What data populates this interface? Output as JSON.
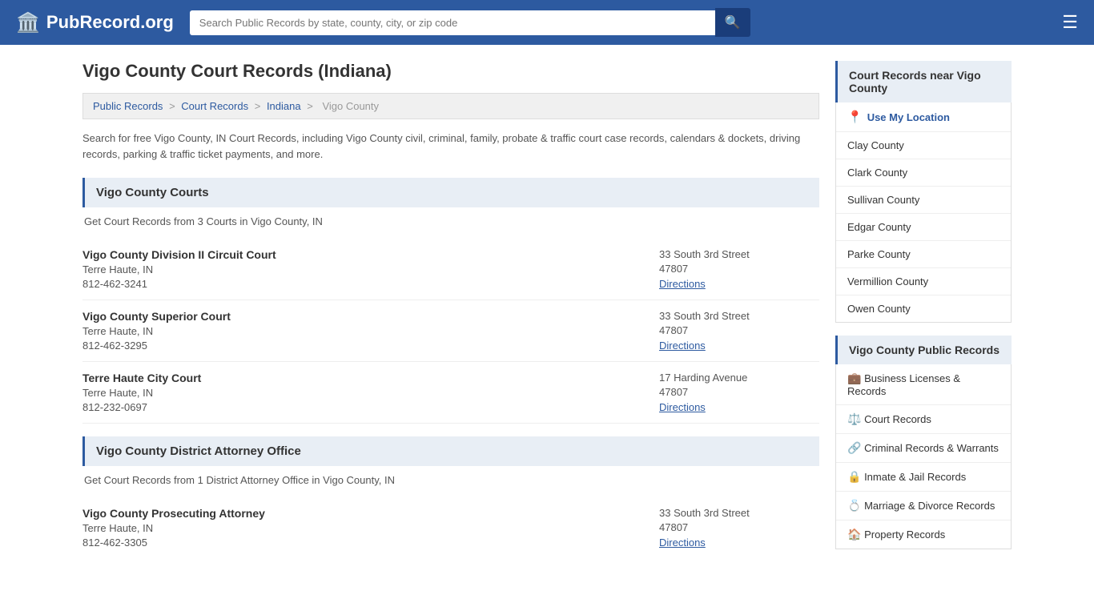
{
  "header": {
    "logo_text": "PubRecord.org",
    "search_placeholder": "Search Public Records by state, county, city, or zip code"
  },
  "page": {
    "title": "Vigo County Court Records (Indiana)",
    "breadcrumb": {
      "items": [
        "Public Records",
        "Court Records",
        "Indiana",
        "Vigo County"
      ]
    },
    "description": "Search for free Vigo County, IN Court Records, including Vigo County civil, criminal, family, probate & traffic court case records, calendars & dockets, driving records, parking & traffic ticket payments, and more.",
    "courts_section": {
      "header": "Vigo County Courts",
      "sub_desc": "Get Court Records from 3 Courts in Vigo County, IN",
      "courts": [
        {
          "name": "Vigo County Division II Circuit Court",
          "city": "Terre Haute, IN",
          "phone": "812-462-3241",
          "address": "33 South 3rd Street",
          "zip": "47807",
          "directions": "Directions"
        },
        {
          "name": "Vigo County Superior Court",
          "city": "Terre Haute, IN",
          "phone": "812-462-3295",
          "address": "33 South 3rd Street",
          "zip": "47807",
          "directions": "Directions"
        },
        {
          "name": "Terre Haute City Court",
          "city": "Terre Haute, IN",
          "phone": "812-232-0697",
          "address": "17 Harding Avenue",
          "zip": "47807",
          "directions": "Directions"
        }
      ]
    },
    "attorney_section": {
      "header": "Vigo County District Attorney Office",
      "sub_desc": "Get Court Records from 1 District Attorney Office in Vigo County, IN",
      "courts": [
        {
          "name": "Vigo County Prosecuting Attorney",
          "city": "Terre Haute, IN",
          "phone": "812-462-3305",
          "address": "33 South 3rd Street",
          "zip": "47807",
          "directions": "Directions"
        }
      ]
    }
  },
  "sidebar": {
    "nearby_header": "Court Records near Vigo County",
    "use_location": "Use My Location",
    "nearby_counties": [
      "Clay County",
      "Clark County",
      "Sullivan County",
      "Edgar County",
      "Parke County",
      "Vermillion County",
      "Owen County"
    ],
    "public_records_header": "Vigo County Public Records",
    "public_records": [
      {
        "label": "Business Licenses & Records",
        "icon": "💼",
        "active": false
      },
      {
        "label": "Court Records",
        "icon": "⚖️",
        "active": true
      },
      {
        "label": "Criminal Records & Warrants",
        "icon": "🔗",
        "active": false
      },
      {
        "label": "Inmate & Jail Records",
        "icon": "🔒",
        "active": false
      },
      {
        "label": "Marriage & Divorce Records",
        "icon": "💍",
        "active": false
      },
      {
        "label": "Property Records",
        "icon": "🏠",
        "active": false
      }
    ]
  }
}
